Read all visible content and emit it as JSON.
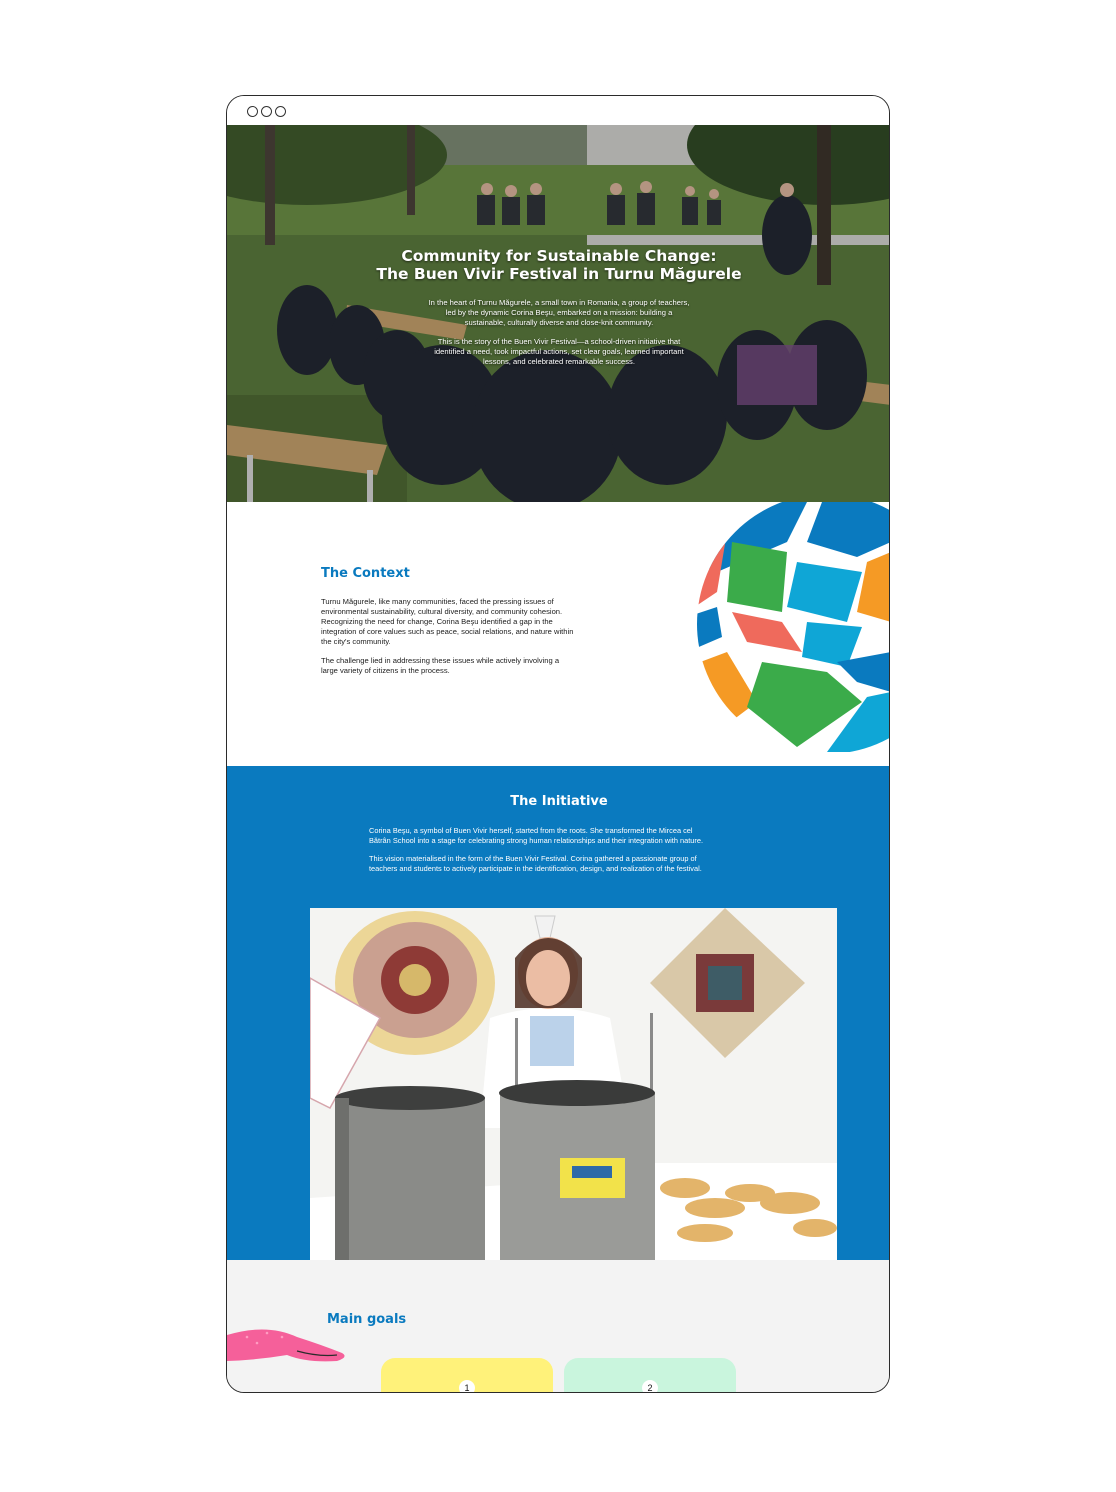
{
  "hero": {
    "title_line1": "Community for Sustainable Change:",
    "title_line2": "The Buen Vivir Festival in Turnu Măgurele",
    "para1_line1": "In the heart of Turnu Măgurele, a small town in Romania, a group of teachers,",
    "para1_line2": "led by the dynamic Corina Beşu, embarked on a mission: building a",
    "para1_line3": "sustainable, culturally diverse and close-knit community.",
    "para2_line1": "This is the story of the Buen Vivir Festival—a school-driven initiative that",
    "para2_line2": "identified a need, took impactful actions, set clear goals, learned important",
    "para2_line3": "lessons, and celebrated remarkable success."
  },
  "context": {
    "heading": "The Context",
    "p1_line1": "Turnu Măgurele, like many communities, faced the pressing issues of",
    "p1_line2": "environmental sustainability, cultural diversity, and community cohesion.",
    "p1_line3": "Recognizing the need for change, Corina Beşu identified a gap in the",
    "p1_line4": "integration of core values such as peace, social relations, and nature within",
    "p1_line5": "the city's community.",
    "p2_line1": "The challenge lied in addressing these issues while actively involving a",
    "p2_line2": "large variety of citizens in the process."
  },
  "initiative": {
    "heading": "The Initiative",
    "p1_line1": "Corina Beşu, a symbol of Buen Vivir herself, started from the roots. She transformed the Mircea cel",
    "p1_line2": "Bătrân School into a stage for celebrating strong human relationships and their integration with nature.",
    "p2_line1": "This vision materialised in the form of the Buen Vivir Festival. Corina gathered a passionate group of",
    "p2_line2": "teachers and students to actively participate in the identification, design, and realization of the festival."
  },
  "goals": {
    "heading": "Main goals",
    "cards": [
      {
        "number": "1",
        "color": "#fff27a"
      },
      {
        "number": "2",
        "color": "#c9f5dd"
      }
    ]
  },
  "colors": {
    "brand_blue": "#0a7abf",
    "globe_green": "#3bab4a",
    "globe_orange": "#f59a25",
    "globe_red": "#ef6a5c",
    "globe_cyan": "#0fa6d6"
  }
}
